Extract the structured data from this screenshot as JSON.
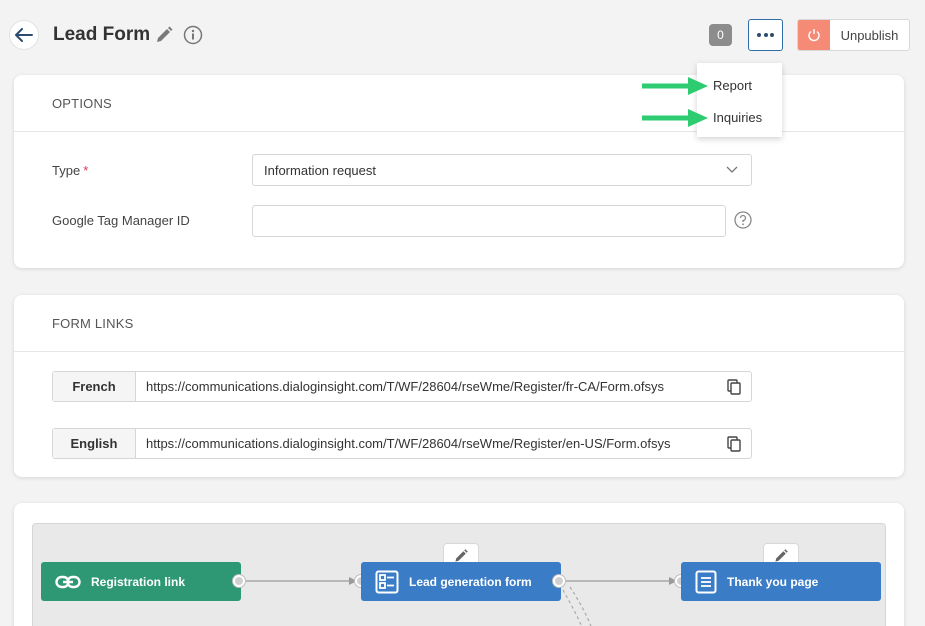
{
  "header": {
    "title": "Lead Form",
    "count": "0",
    "unpublish_label": "Unpublish"
  },
  "menu": {
    "items": [
      {
        "label": "Report"
      },
      {
        "label": "Inquiries"
      }
    ]
  },
  "options": {
    "section_title": "OPTIONS",
    "type_label": "Type",
    "type_required_mark": "*",
    "type_value": "Information request",
    "gtm_label": "Google Tag Manager ID",
    "gtm_value": ""
  },
  "form_links": {
    "section_title": "FORM LINKS",
    "links": [
      {
        "lang": "French",
        "url": "https://communications.dialoginsight.com/T/WF/28604/rseWme/Register/fr-CA/Form.ofsys"
      },
      {
        "lang": "English",
        "url": "https://communications.dialoginsight.com/T/WF/28604/rseWme/Register/en-US/Form.ofsys"
      }
    ]
  },
  "workflow": {
    "nodes": [
      {
        "label": "Registration link",
        "icon": "link-icon",
        "color": "#2e9874"
      },
      {
        "label": "Lead generation form",
        "icon": "form-icon",
        "color": "#3a7cc6"
      },
      {
        "label": "Thank you page",
        "icon": "page-icon",
        "color": "#3a7cc6"
      }
    ]
  },
  "colors": {
    "accent": "#2f6ea8",
    "unpublish": "#f58a76",
    "arrow": "#2ecc71",
    "required": "#e0344e"
  }
}
